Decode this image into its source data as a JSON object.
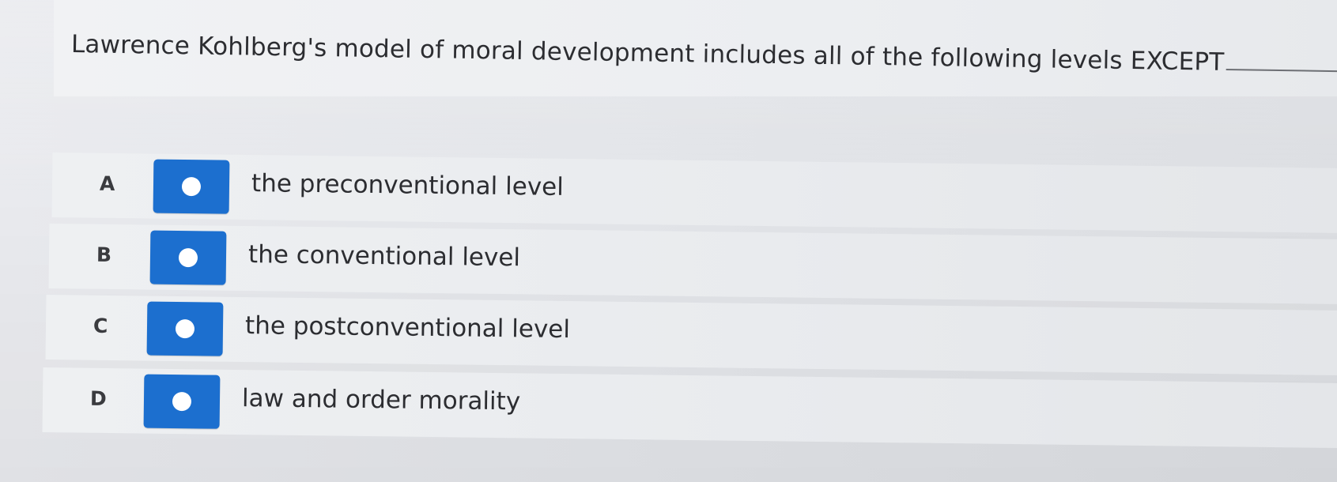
{
  "question": {
    "text": "Lawrence Kohlberg's model of moral development includes all of the following levels EXCEPT"
  },
  "options": [
    {
      "letter": "A",
      "label": "the preconventional level",
      "selected": false
    },
    {
      "letter": "B",
      "label": "the conventional level",
      "selected": false
    },
    {
      "letter": "C",
      "label": "the postconventional level",
      "selected": false
    },
    {
      "letter": "D",
      "label": "law and order morality",
      "selected": false
    }
  ],
  "colors": {
    "radio_background": "#1c6fcf",
    "radio_dot": "#ffffff",
    "text": "#2c2d31"
  }
}
